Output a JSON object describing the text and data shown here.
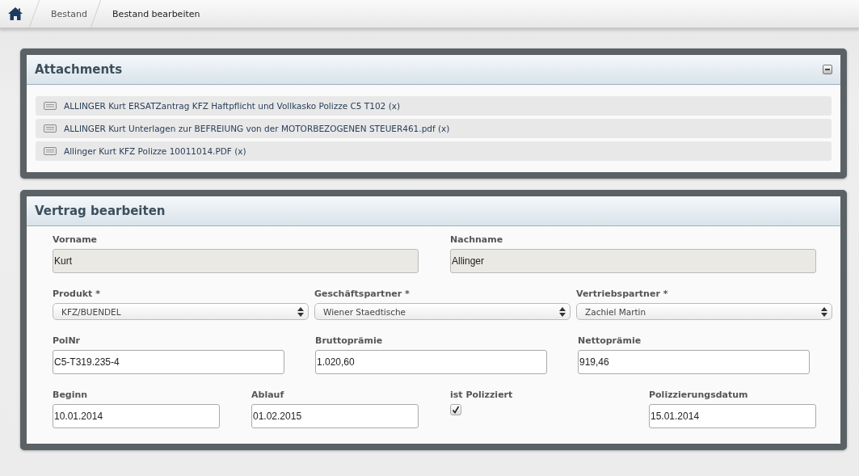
{
  "breadcrumb": [
    {
      "label": "Bestand",
      "current": false
    },
    {
      "label": "Bestand bearbeiten",
      "current": true
    }
  ],
  "attachments": {
    "title": "Attachments",
    "files": [
      {
        "label": "ALLINGER Kurt ERSATZantrag KFZ Haftpflicht und Vollkasko Polizze C5 T102 (x)"
      },
      {
        "label": "ALLINGER Kurt Unterlagen zur BEFREIUNG von der MOTORBEZOGENEN STEUER461.pdf (x)"
      },
      {
        "label": "Allinger Kurt KFZ Polizze 10011014.PDF (x)"
      }
    ]
  },
  "contract": {
    "title": "Vertrag bearbeiten",
    "rows": [
      [
        {
          "kind": "text",
          "label": "Vorname",
          "value": "Kurt",
          "readonly": true
        },
        {
          "kind": "text",
          "label": "Nachname",
          "value": "Allinger",
          "readonly": true
        }
      ],
      [
        {
          "kind": "select",
          "label": "Produkt *",
          "value": "KFZ/BUENDEL"
        },
        {
          "kind": "select",
          "label": "Geschäftspartner *",
          "value": "Wiener Staedtische"
        },
        {
          "kind": "select",
          "label": "Vertriebspartner *",
          "value": "Zachiel Martin"
        }
      ],
      [
        {
          "kind": "text",
          "label": "PolNr",
          "value": "C5-T319.235-4",
          "readonly": false
        },
        {
          "kind": "text",
          "label": "Bruttoprämie",
          "value": "1.020,60",
          "readonly": false
        },
        {
          "kind": "text",
          "label": "Nettoprämie",
          "value": "919,46",
          "readonly": false
        }
      ],
      [
        {
          "kind": "text",
          "label": "Beginn",
          "value": "10.01.2014",
          "readonly": false
        },
        {
          "kind": "text",
          "label": "Ablauf",
          "value": "01.02.2015",
          "readonly": false
        },
        {
          "kind": "checkbox",
          "label": "ist Polizziert",
          "checked": true
        },
        {
          "kind": "text",
          "label": "Polizzierungsdatum",
          "value": "15.01.2014",
          "readonly": false
        }
      ]
    ]
  }
}
